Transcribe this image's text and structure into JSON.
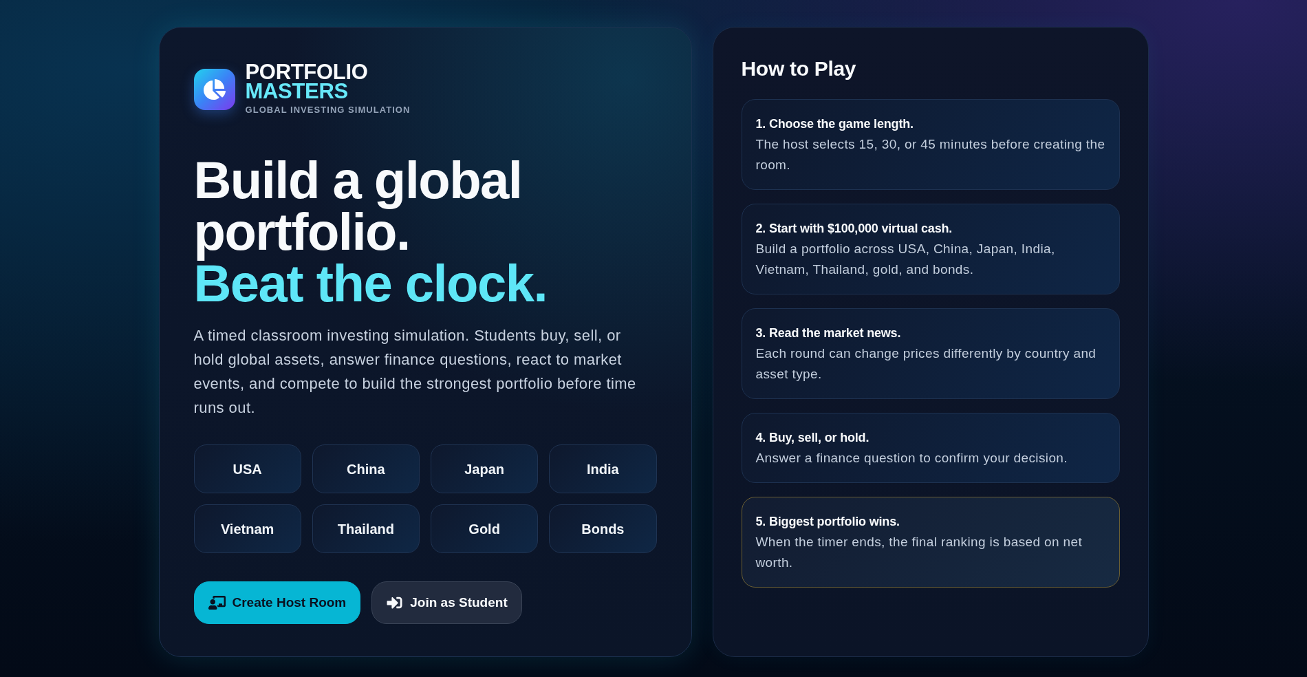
{
  "brand": {
    "name_line_1": "PORTFOLIO",
    "name_line_2": "MASTERS",
    "tagline": "GLOBAL INVESTING SIMULATION"
  },
  "hero": {
    "headline": "Build a global portfolio.",
    "headline_accent": "Beat the clock.",
    "description": "A timed classroom investing simulation. Students buy, sell, or hold global assets, answer finance questions, react to market events, and compete to build the strongest portfolio before time runs out."
  },
  "assets": [
    "USA",
    "China",
    "Japan",
    "India",
    "Vietnam",
    "Thailand",
    "Gold",
    "Bonds"
  ],
  "actions": [
    {
      "kind": "primary",
      "label": "Create Host Room"
    },
    {
      "kind": "secondary",
      "label": "Join as Student"
    }
  ],
  "how_to_play": {
    "title": "How to Play",
    "steps": [
      {
        "title": "1. Choose the game length.",
        "text": "The host selects 15, 30, or 45 minutes before creating the room.",
        "highlighted": false
      },
      {
        "title": "2. Start with $100,000 virtual cash.",
        "text": "Build a portfolio across USA, China, Japan, India, Vietnam, Thailand, gold, and bonds.",
        "highlighted": false
      },
      {
        "title": "3. Read the market news.",
        "text": "Each round can change prices differently by country and asset type.",
        "highlighted": false
      },
      {
        "title": "4. Buy, sell, or hold.",
        "text": "Answer a finance question to confirm your decision.",
        "highlighted": false
      },
      {
        "title": "5. Biggest portfolio wins.",
        "text": "When the timer ends, the final ranking is based on net worth.",
        "highlighted": true
      }
    ]
  }
}
